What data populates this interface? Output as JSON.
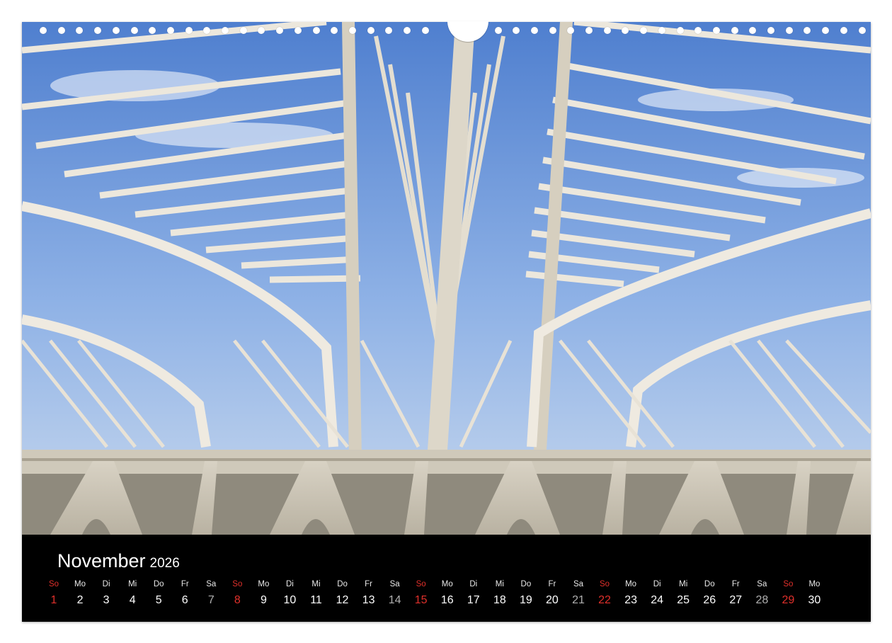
{
  "calendar": {
    "month": "November",
    "year": "2026",
    "days": [
      {
        "wd": "So",
        "n": "1",
        "type": "sun"
      },
      {
        "wd": "Mo",
        "n": "2",
        "type": "wk"
      },
      {
        "wd": "Di",
        "n": "3",
        "type": "wk"
      },
      {
        "wd": "Mi",
        "n": "4",
        "type": "wk"
      },
      {
        "wd": "Do",
        "n": "5",
        "type": "wk"
      },
      {
        "wd": "Fr",
        "n": "6",
        "type": "wk"
      },
      {
        "wd": "Sa",
        "n": "7",
        "type": "sat"
      },
      {
        "wd": "So",
        "n": "8",
        "type": "sun"
      },
      {
        "wd": "Mo",
        "n": "9",
        "type": "wk"
      },
      {
        "wd": "Di",
        "n": "10",
        "type": "wk"
      },
      {
        "wd": "Mi",
        "n": "11",
        "type": "wk"
      },
      {
        "wd": "Do",
        "n": "12",
        "type": "wk"
      },
      {
        "wd": "Fr",
        "n": "13",
        "type": "wk"
      },
      {
        "wd": "Sa",
        "n": "14",
        "type": "sat"
      },
      {
        "wd": "So",
        "n": "15",
        "type": "sun"
      },
      {
        "wd": "Mo",
        "n": "16",
        "type": "wk"
      },
      {
        "wd": "Di",
        "n": "17",
        "type": "wk"
      },
      {
        "wd": "Mi",
        "n": "18",
        "type": "wk"
      },
      {
        "wd": "Do",
        "n": "19",
        "type": "wk"
      },
      {
        "wd": "Fr",
        "n": "20",
        "type": "wk"
      },
      {
        "wd": "Sa",
        "n": "21",
        "type": "sat"
      },
      {
        "wd": "So",
        "n": "22",
        "type": "sun"
      },
      {
        "wd": "Mo",
        "n": "23",
        "type": "wk"
      },
      {
        "wd": "Di",
        "n": "24",
        "type": "wk"
      },
      {
        "wd": "Mi",
        "n": "25",
        "type": "wk"
      },
      {
        "wd": "Do",
        "n": "26",
        "type": "wk"
      },
      {
        "wd": "Fr",
        "n": "27",
        "type": "wk"
      },
      {
        "wd": "Sa",
        "n": "28",
        "type": "sat"
      },
      {
        "wd": "So",
        "n": "29",
        "type": "sun"
      },
      {
        "wd": "Mo",
        "n": "30",
        "type": "wk"
      }
    ]
  },
  "colors": {
    "sunday": "#e0302b",
    "saturday": "#b0b0b0",
    "weekday": "#ffffff",
    "calendar_bg": "#000000"
  },
  "photo": {
    "subject": "white-steel-glass-roof-structure"
  }
}
